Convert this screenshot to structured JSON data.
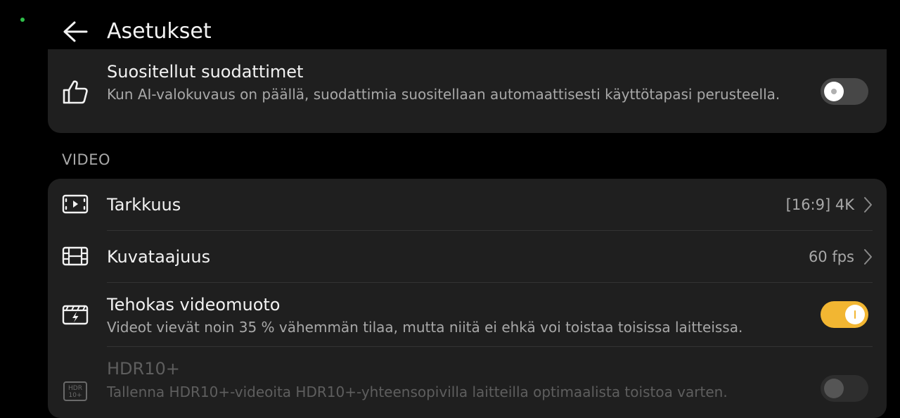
{
  "header": {
    "title": "Asetukset",
    "back_icon": "arrow-left-icon"
  },
  "top_card": {
    "title": "Suositellut suodattimet",
    "description": "Kun AI-valokuvaus on päällä, suodattimia suositellaan automaattisesti käyttötapasi perusteella.",
    "icon": "thumbs-up-icon",
    "toggle_on": false
  },
  "video_section": {
    "label": "VIDEO",
    "items": [
      {
        "title": "Tarkkuus",
        "value": "[16:9] 4K",
        "icon": "video-resolution-icon"
      },
      {
        "title": "Kuvataajuus",
        "value": "60 fps",
        "icon": "film-frames-icon"
      },
      {
        "title": "Tehokas videomuoto",
        "description": "Videot vievät noin 35 % vähemmän tilaa, mutta niitä ei ehkä voi toistaa toisissa laitteissa.",
        "icon": "video-efficiency-icon",
        "toggle_on": true
      },
      {
        "title": "HDR10+",
        "description": "Tallenna HDR10+-videoita HDR10+-yhteensopivilla laitteilla optimaalista toistoa varten.",
        "icon": "hdr10-plus-icon",
        "icon_text_top": "HDR",
        "icon_text_bottom": "10+",
        "toggle_on": false,
        "disabled": true
      }
    ]
  },
  "colors": {
    "background": "#000000",
    "card": "#1f1f1f",
    "accent": "#f2b632",
    "text_primary": "#f2f2f2",
    "text_secondary": "#a8a8a8"
  }
}
